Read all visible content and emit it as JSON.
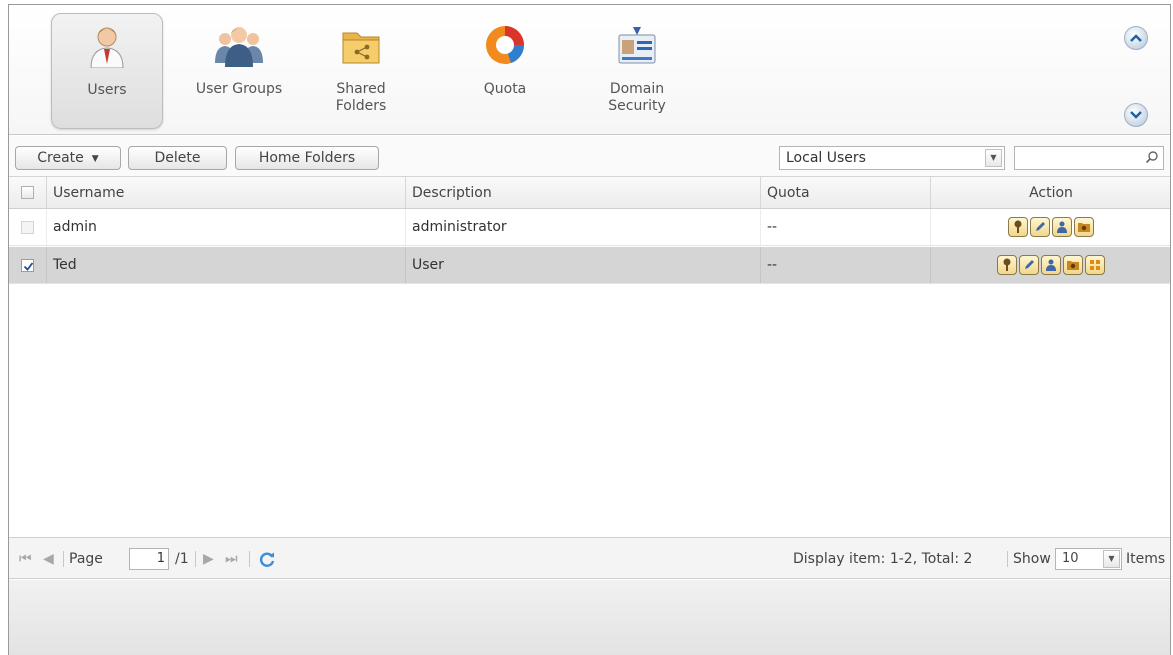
{
  "nav": {
    "items": [
      {
        "label": "Users",
        "icon": "user-icon",
        "active": true
      },
      {
        "label": "User Groups",
        "icon": "user-groups-icon",
        "active": false
      },
      {
        "label": "Shared\nFolders",
        "icon": "shared-folder-icon",
        "active": false
      },
      {
        "label": "Quota",
        "icon": "quota-icon",
        "active": false
      },
      {
        "label": "Domain\nSecurity",
        "icon": "domain-security-icon",
        "active": false
      }
    ],
    "scroll_up_icon": "chevron-up-icon",
    "scroll_down_icon": "chevron-down-icon"
  },
  "toolbar": {
    "create_label": "Create",
    "delete_label": "Delete",
    "home_folders_label": "Home Folders",
    "filter_value": "Local Users",
    "search_value": ""
  },
  "grid": {
    "columns": {
      "username": "Username",
      "description": "Description",
      "quota": "Quota",
      "action": "Action"
    },
    "rows": [
      {
        "username": "admin",
        "description": "administrator",
        "quota": "--",
        "selected": false,
        "actions": [
          "change-password-icon",
          "edit-icon",
          "user-group-icon",
          "shared-folder-permission-icon"
        ]
      },
      {
        "username": "Ted",
        "description": "User",
        "quota": "--",
        "selected": true,
        "actions": [
          "change-password-icon",
          "edit-icon",
          "user-group-icon",
          "shared-folder-permission-icon",
          "application-privilege-icon"
        ]
      }
    ]
  },
  "pager": {
    "page_label": "Page",
    "page_value": "1",
    "page_total": "/1",
    "display_info": "Display item: 1-2, Total: 2",
    "show_label": "Show",
    "show_value": "10",
    "items_label": "Items"
  },
  "colors": {
    "selected_row": "#d5d5d5",
    "action_button": "#f1d78a",
    "accent": "#3a8fd8"
  }
}
